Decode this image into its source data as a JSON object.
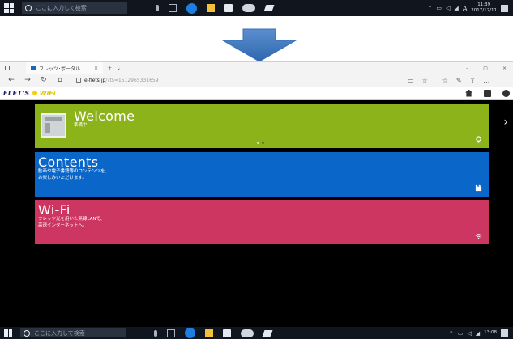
{
  "taskbar_top": {
    "search_placeholder": "ここに入力して検索",
    "clock_time": "11:39",
    "clock_date": "2017/12/11",
    "ime": "A"
  },
  "taskbar_bottom": {
    "search_placeholder": "ここに入力して検索",
    "clock_time": "13:08"
  },
  "browser": {
    "tab_title": "フレッツ･ポータル",
    "tab_close": "×",
    "new_tab": "+",
    "tab_menu": "⌄",
    "win_min": "–",
    "win_max": "▢",
    "win_close": "×",
    "back": "←",
    "forward": "→",
    "refresh": "↻",
    "home": "⌂",
    "url": "e-flets.jp",
    "url_rest": "/?ts=1512965331659",
    "reading_view": "▭",
    "favorite": "☆",
    "favorites_hub": "☆",
    "notes": "✎",
    "share": "⇪",
    "more": "…"
  },
  "site": {
    "brand": "FLET'S",
    "brand_wifi": "WiFi",
    "head_icons": [
      "home-icon",
      "book-icon",
      "gear-icon"
    ]
  },
  "tiles": {
    "welcome": {
      "title": "Welcome",
      "sub": "準備中"
    },
    "contents": {
      "title": "Contents",
      "sub1": "動画や電子書籍等のコンテンツを、",
      "sub2": "お楽しみいただけます。"
    },
    "wifi": {
      "title": "Wi-Fi",
      "sub1": "フレッツ光を用いた無線LANで、",
      "sub2": "高速インターネットへ。"
    },
    "next": "›"
  },
  "colors": {
    "welcome": "#8db31a",
    "contents": "#0a66c8",
    "wifi": "#cd3660",
    "arrow": "#4a7fc0"
  }
}
